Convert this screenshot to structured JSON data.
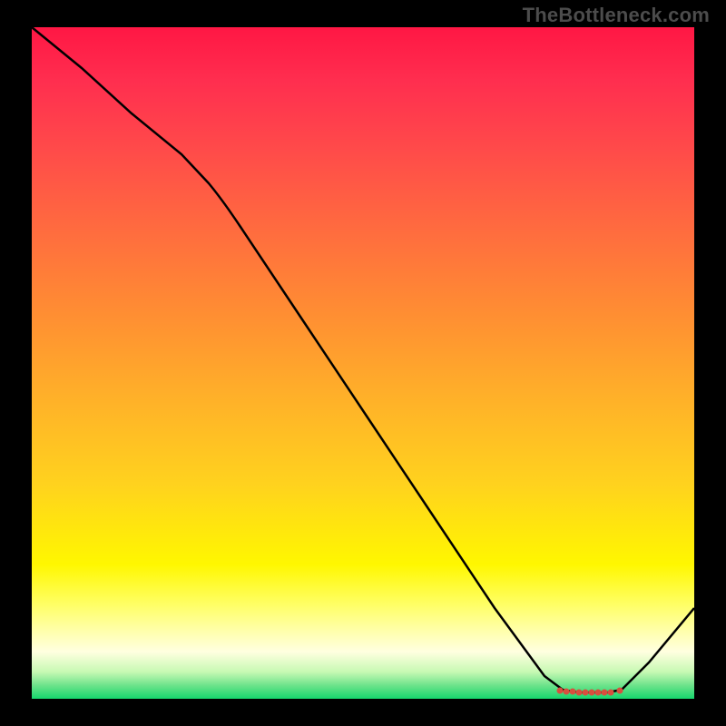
{
  "watermark": "TheBottleneck.com",
  "chart_data": {
    "type": "line",
    "title": "",
    "xlabel": "",
    "ylabel": "",
    "xlim": [
      0,
      100
    ],
    "ylim": [
      0,
      100
    ],
    "gradient_colors": {
      "top": "#ff1744",
      "mid": "#ffd21e",
      "bottom": "#16d66d"
    },
    "x": [
      0,
      25,
      80,
      85,
      100
    ],
    "values": [
      100,
      78,
      1,
      0.5,
      14
    ],
    "flat_region": {
      "x_start": 80,
      "x_end": 85,
      "y": 0.5
    },
    "notes": "Line descends from top-left, bends near x≈25, reaches minimum near x≈80–85 with a cluster of red points along the bottom, then rises toward the right edge."
  }
}
